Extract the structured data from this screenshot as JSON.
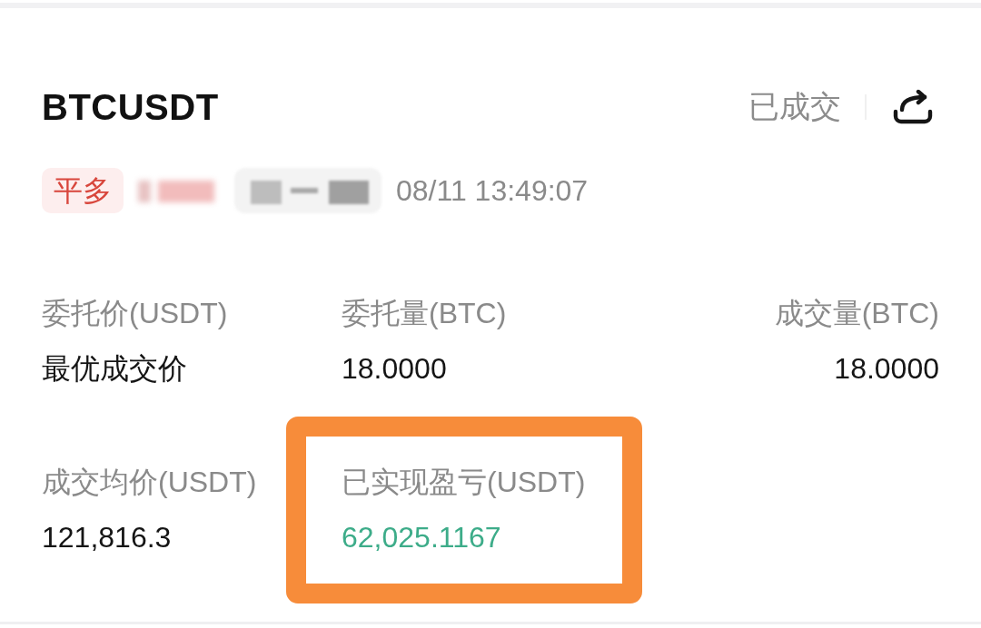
{
  "order": {
    "symbol": "BTCUSDT",
    "status": "已成交",
    "side_tag": "平多",
    "redactions": [
      {
        "kind": "tag"
      },
      {
        "kind": "chip"
      }
    ],
    "time": "08/11 13:49:07",
    "fields": [
      {
        "label": "委托价(USDT)",
        "value": "最优成交价",
        "color": "#151515",
        "highlighted": false
      },
      {
        "label": "委托量(BTC)",
        "value": "18.0000",
        "color": "#151515",
        "highlighted": false
      },
      {
        "label": "成交量(BTC)",
        "value": "18.0000",
        "color": "#151515",
        "highlighted": false
      },
      {
        "label": "成交均价(USDT)",
        "value": "121,816.3",
        "color": "#151515",
        "highlighted": false
      },
      {
        "label": "已实现盈亏(USDT)",
        "value": "62,025.1167",
        "color": "#3dac89",
        "highlighted": true
      }
    ]
  }
}
